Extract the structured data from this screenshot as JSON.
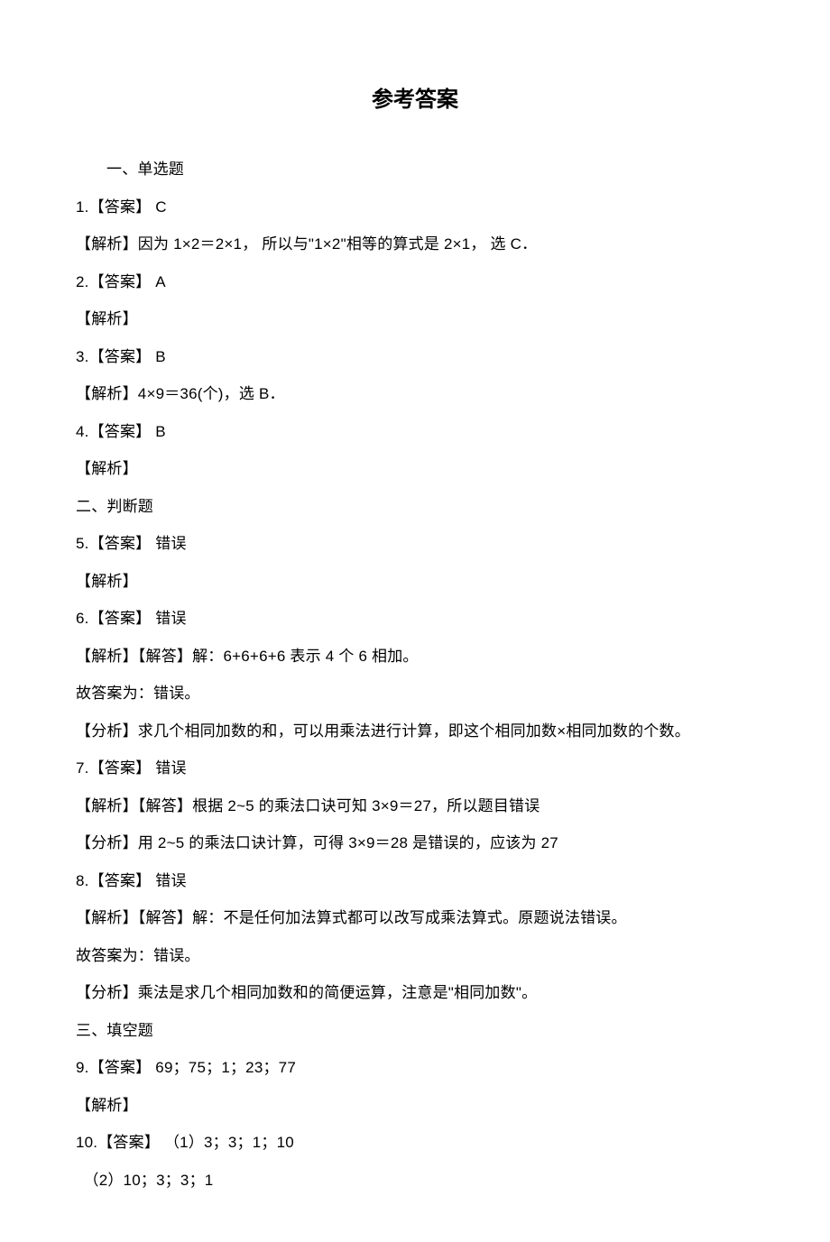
{
  "title": "参考答案",
  "section1": "一、单选题",
  "q1_ans": "1.【答案】  C",
  "q1_exp": "【解析】因为 1×2＝2×1，  所以与\"1×2\"相等的算式是 2×1，  选 C．",
  "q2_ans": "2.【答案】  A",
  "q2_exp": "【解析】",
  "q3_ans": "3.【答案】  B",
  "q3_exp": "【解析】4×9＝36(个)，选 B．",
  "q4_ans": "4.【答案】  B",
  "q4_exp": "【解析】",
  "section2": "二、判断题",
  "q5_ans": "5.【答案】  错误",
  "q5_exp": "【解析】",
  "q6_ans": "6.【答案】  错误",
  "q6_exp1": "【解析】【解答】解：6+6+6+6 表示 4 个 6 相加。",
  "q6_exp2": " 故答案为：错误。",
  "q6_exp3": "【分析】求几个相同加数的和，可以用乘法进行计算，即这个相同加数×相同加数的个数。",
  "q7_ans": "7.【答案】  错误",
  "q7_exp1": "【解析】【解答】根据 2~5 的乘法口诀可知 3×9＝27，所以题目错误",
  "q7_exp2": "【分析】用 2~5 的乘法口诀计算，可得 3×9＝28 是错误的，应该为 27",
  "q8_ans": "8.【答案】  错误",
  "q8_exp1": "【解析】【解答】解：不是任何加法算式都可以改写成乘法算式。原题说法错误。",
  "q8_exp2": " 故答案为：错误。",
  "q8_exp3": " 【分析】乘法是求几个相同加数和的简便运算，注意是\"相同加数\"。",
  "section3": "三、填空题",
  "q9_ans": "9.【答案】  69；75；1；23；77",
  "q9_exp": "【解析】",
  "q10_ans": "10.【答案】  （1）3；3；1；10",
  "q10_b": "（2）10；3；3；1"
}
